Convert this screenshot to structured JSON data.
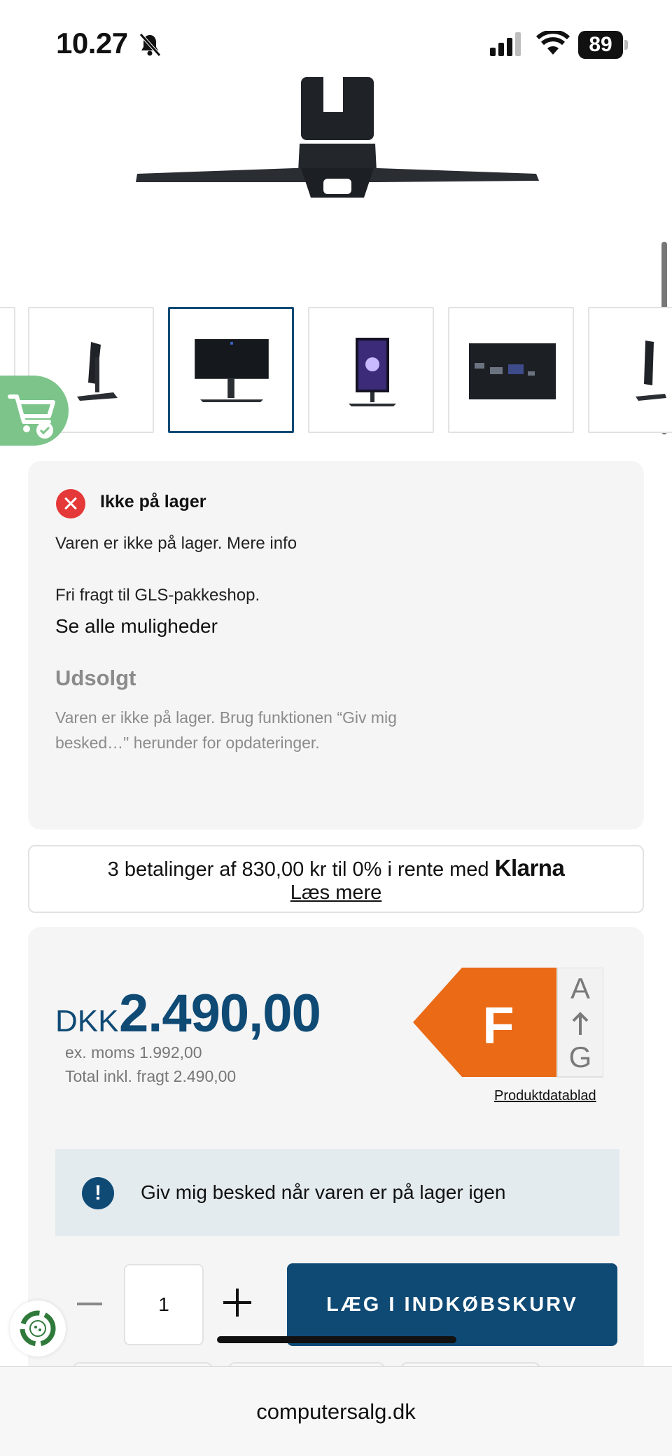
{
  "status_bar": {
    "time": "10.27",
    "battery": "89"
  },
  "colors": {
    "brand": "#0f4a75",
    "error": "#e53838",
    "energy_class": "#ea6a16",
    "cart_float": "#7cc48a"
  },
  "gallery": {
    "thumbnails": [
      "monitor-side-view",
      "monitor-back-view",
      "monitor-front-view",
      "monitor-ports-closeup",
      "monitor-side-view-2"
    ],
    "active_index": 1
  },
  "stock": {
    "status_title": "Ikke på lager",
    "info": "Varen er ikke på lager. Mere info",
    "shipping": "Fri fragt til GLS-pakkeshop.",
    "see_all": "Se alle muligheder",
    "soldout_title": "Udsolgt",
    "soldout_text": "Varen er ikke på lager. Brug funktionen “Giv mig besked…\" herunder for opdateringer."
  },
  "klarna": {
    "text": "3 betalinger af 830,00 kr til 0% i rente med",
    "brand": "Klarna",
    "link": "Læs mere"
  },
  "price": {
    "currency": "DKK",
    "amount": "2.490,00",
    "ex_moms": "ex. moms 1.992,00",
    "total": "Total inkl. fragt 2.490,00"
  },
  "energy": {
    "class": "F",
    "scale_top": "A",
    "scale_bottom": "G",
    "datasheet_link": "Produktdatablad"
  },
  "notify": {
    "icon": "exclamation-icon",
    "text": "Giv mig besked når varen er på lager igen"
  },
  "cart": {
    "quantity": "1",
    "add_button": "LÆG I INDKØBSKURV"
  },
  "browser": {
    "domain": "computersalg.dk"
  }
}
